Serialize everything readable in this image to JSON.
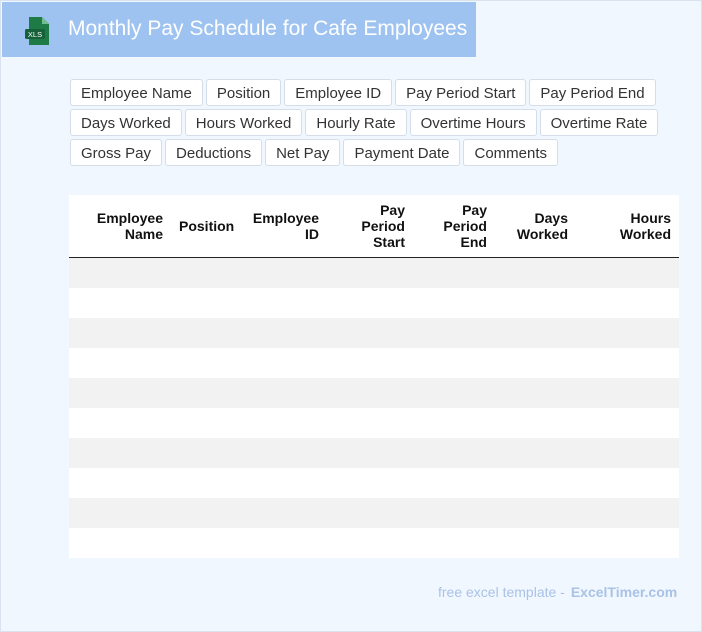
{
  "header": {
    "title": "Monthly Pay Schedule for Cafe Employees",
    "icon_label": "XLS"
  },
  "fields": [
    [
      "Employee Name",
      "Position",
      "Employee ID",
      "Pay Period Start",
      "Pay Period End"
    ],
    [
      "Days Worked",
      "Hours Worked",
      "Hourly Rate",
      "Overtime Hours",
      "Overtime Rate"
    ],
    [
      "Gross Pay",
      "Deductions",
      "Net Pay",
      "Payment Date",
      "Comments"
    ]
  ],
  "table": {
    "columns": [
      "Employee Name",
      "Position",
      "Employee ID",
      "Pay Period Start",
      "Pay Period End",
      "Days Worked",
      "Hours Worked"
    ],
    "row_count": 10
  },
  "footer": {
    "text": "free excel template -",
    "brand": "ExcelTimer.com"
  }
}
